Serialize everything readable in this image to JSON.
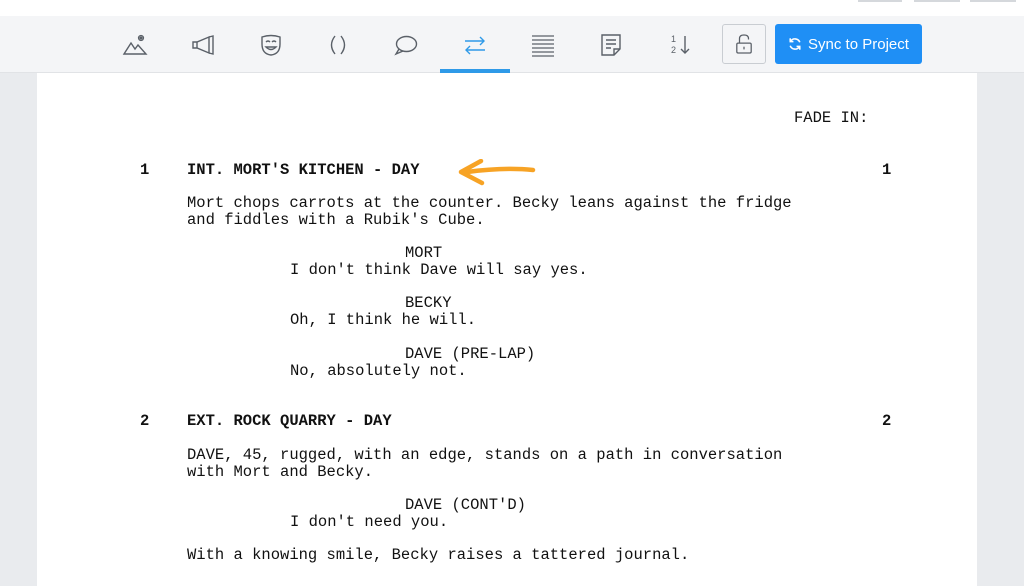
{
  "toolbar": {
    "tools": [
      {
        "name": "mountain-icon"
      },
      {
        "name": "megaphone-icon"
      },
      {
        "name": "mask-icon"
      },
      {
        "name": "parentheses-icon"
      },
      {
        "name": "speech-bubble-icon"
      },
      {
        "name": "transition-arrows-icon"
      },
      {
        "name": "lines-icon"
      },
      {
        "name": "note-icon"
      },
      {
        "name": "numbering-icon"
      }
    ],
    "active_tool": "transition-arrows-icon",
    "numbering_label": "1\n2",
    "sync_label": "Sync to Project",
    "accent_color": "#2f9ae8",
    "sync_color": "#1f8ff5"
  },
  "script": {
    "transition": "FADE IN:",
    "scenes": [
      {
        "number": "1",
        "heading": "INT. MORT'S KITCHEN - DAY",
        "action": [
          "Mort chops carrots at the counter. Becky leans against the fridge",
          "and fiddles with a Rubik's Cube."
        ],
        "dialogue": [
          {
            "character": "MORT",
            "line": "I don't think Dave will say yes."
          },
          {
            "character": "BECKY",
            "line": "Oh, I think he will."
          },
          {
            "character": "DAVE (PRE-LAP)",
            "line": "No, absolutely not."
          }
        ]
      },
      {
        "number": "2",
        "heading": "EXT. ROCK QUARRY - DAY",
        "action": [
          "DAVE, 45, rugged, with an edge, stands on a path in conversation",
          "with Mort and Becky."
        ],
        "dialogue": [
          {
            "character": "DAVE (CONT'D)",
            "line": "I don't need you."
          }
        ],
        "action2": "With a knowing smile, Becky raises a tattered journal."
      }
    ]
  },
  "annotation_color": "#f7a325"
}
